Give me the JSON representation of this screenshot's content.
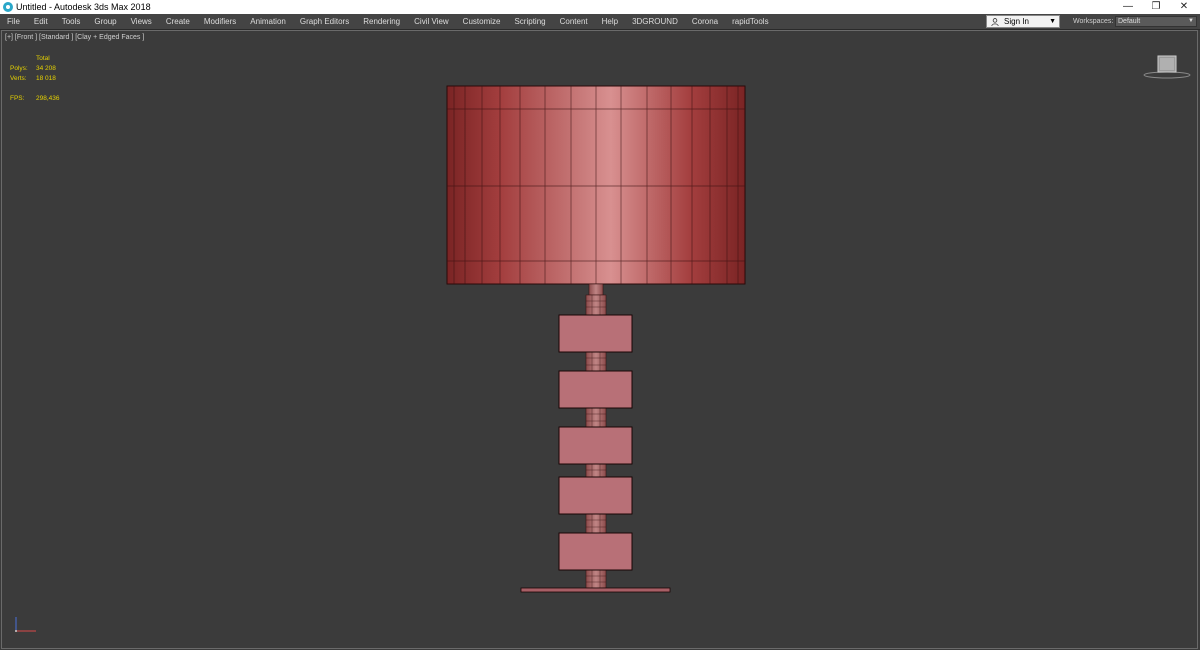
{
  "window": {
    "title": "Untitled - Autodesk 3ds Max 2018",
    "minimize_glyph": "—",
    "restore_glyph": "❐",
    "close_glyph": "✕",
    "app_icon": "3ds-max-logo-icon"
  },
  "menubar": {
    "items": [
      "File",
      "Edit",
      "Tools",
      "Group",
      "Views",
      "Create",
      "Modifiers",
      "Animation",
      "Graph Editors",
      "Rendering",
      "Civil View",
      "Customize",
      "Scripting",
      "Content",
      "Help",
      "3DGROUND",
      "Corona",
      "rapidTools"
    ],
    "sign_in": "Sign In",
    "sign_in_arrow": "▼",
    "workspaces_label": "Workspaces:",
    "workspaces_value": "Default",
    "workspaces_arrow": "▼"
  },
  "viewport": {
    "label": "[+] [Front ] [Standard ] [Clay + Edged Faces ]",
    "stats": {
      "total_label": "Total",
      "polys_label": "Polys:",
      "polys_value": "34 208",
      "verts_label": "Verts:",
      "verts_value": "18 018",
      "fps_label": "FPS:",
      "fps_value": "298,436"
    }
  },
  "colors": {
    "viewport_bg": "#3b3b3b",
    "shade_edge": "#7a2424",
    "shade_mid": "#b04848",
    "shade_highlight": "#d89090",
    "block_fill": "#b87077",
    "stat_text": "#e6d200"
  },
  "icons": [
    "user-icon",
    "viewcube-icon",
    "axis-tripod-icon"
  ]
}
